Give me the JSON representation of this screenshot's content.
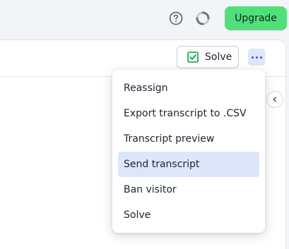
{
  "topbar": {
    "help_icon": "question-circle-icon",
    "loader_icon": "loading-ring-icon",
    "upgrade_label": "Upgrade",
    "upgrade_color": "#4fe07a"
  },
  "toolbar": {
    "solve_label": "Solve",
    "solve_icon": "check-square-icon",
    "more_icon": "more-horizontal-icon",
    "collapse_icon": "chevron-left-icon"
  },
  "menu": {
    "items": [
      {
        "label": "Reassign",
        "active": false
      },
      {
        "label": "Export transcript to .CSV",
        "active": false
      },
      {
        "label": "Transcript preview",
        "active": false
      },
      {
        "label": "Send transcript",
        "active": true
      },
      {
        "label": "Ban visitor",
        "active": false
      },
      {
        "label": "Solve",
        "active": false
      }
    ],
    "active_color": "#dde6fb"
  }
}
